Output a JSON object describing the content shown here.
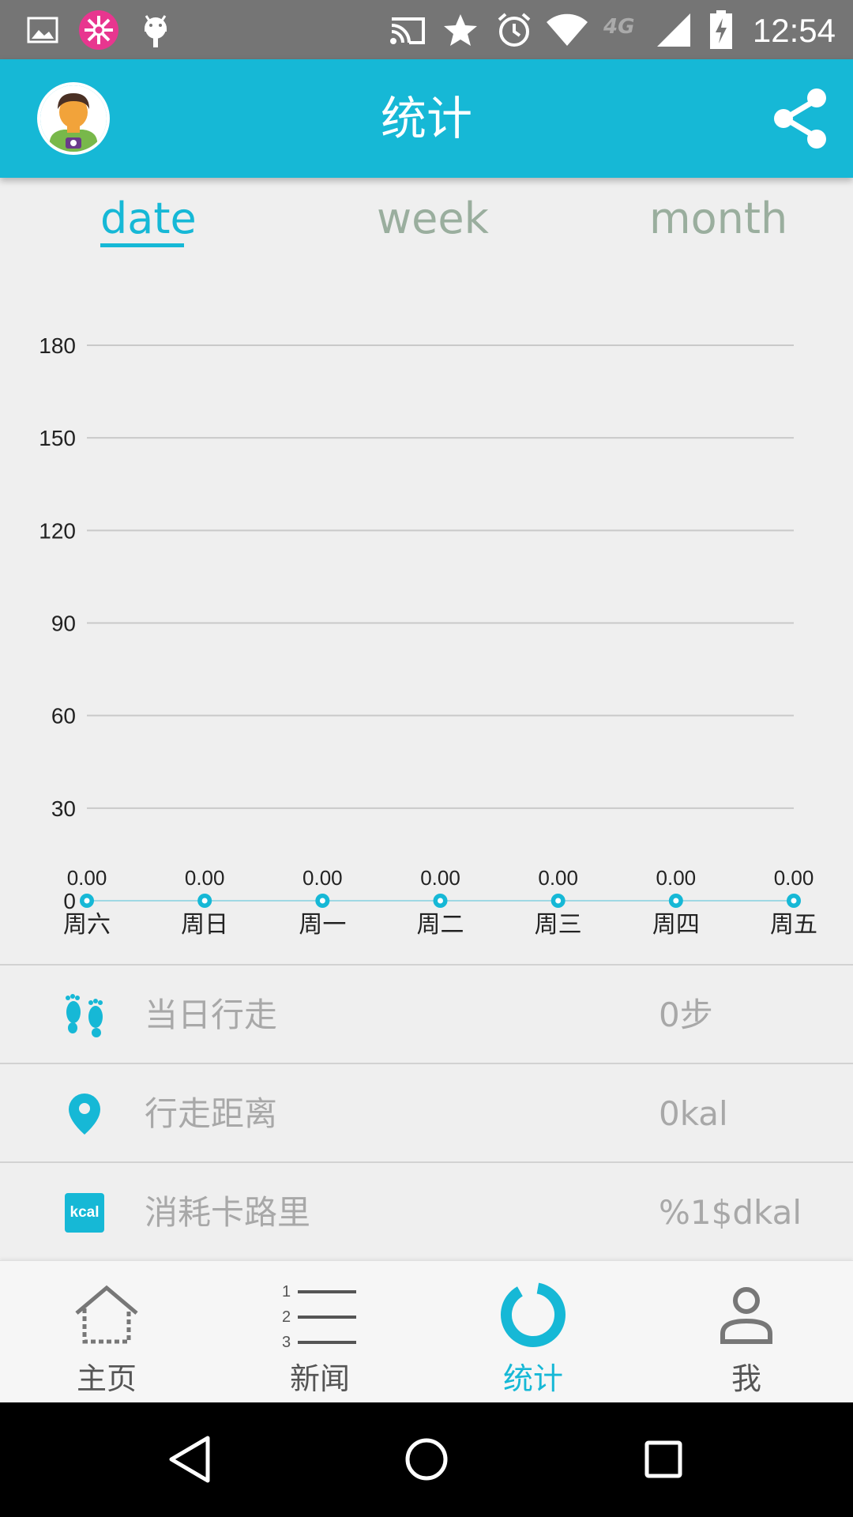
{
  "status_bar": {
    "time": "12:54",
    "network": "4G",
    "icons": [
      "image-icon",
      "flower-icon",
      "android-icon",
      "cast-icon",
      "star-icon",
      "alarm-icon",
      "wifi-icon",
      "signal-icon",
      "battery-charging-icon"
    ]
  },
  "app_bar": {
    "title": "统计",
    "avatar_icon": "avatar-icon",
    "share_icon": "share-icon"
  },
  "tabs": [
    {
      "label": "date",
      "active": true
    },
    {
      "label": "week",
      "active": false
    },
    {
      "label": "month",
      "active": false
    }
  ],
  "chart_data": {
    "type": "line",
    "categories": [
      "周六",
      "周日",
      "周一",
      "周二",
      "周三",
      "周四",
      "周五"
    ],
    "values": [
      0,
      0,
      0,
      0,
      0,
      0,
      0
    ],
    "data_labels": [
      "0.00",
      "0.00",
      "0.00",
      "0.00",
      "0.00",
      "0.00",
      "0.00"
    ],
    "y_ticks": [
      "0",
      "30",
      "60",
      "90",
      "120",
      "150",
      "180"
    ],
    "ylim": [
      0,
      180
    ],
    "grid": true,
    "colors": {
      "line": "#16b8d6",
      "grid": "#c9c9c9"
    }
  },
  "stats": [
    {
      "icon": "footprints-icon",
      "label": "当日行走",
      "value": "0步"
    },
    {
      "icon": "location-pin-icon",
      "label": "行走距离",
      "value": "0kal"
    },
    {
      "icon": "kcal-icon",
      "icon_text": "kcal",
      "label": "消耗卡路里",
      "value": "%1$dkal"
    }
  ],
  "bottom_nav": [
    {
      "icon": "home-icon",
      "label": "主页",
      "active": false
    },
    {
      "icon": "list-icon",
      "label": "新闻",
      "active": false,
      "list_numbers": [
        "1",
        "2",
        "3"
      ]
    },
    {
      "icon": "stats-ring-icon",
      "label": "统计",
      "active": true
    },
    {
      "icon": "person-icon",
      "label": "我",
      "active": false
    }
  ],
  "colors": {
    "accent": "#16b8d6",
    "tab_inactive": "#9aae9e",
    "muted_text": "#a8a8a8"
  }
}
